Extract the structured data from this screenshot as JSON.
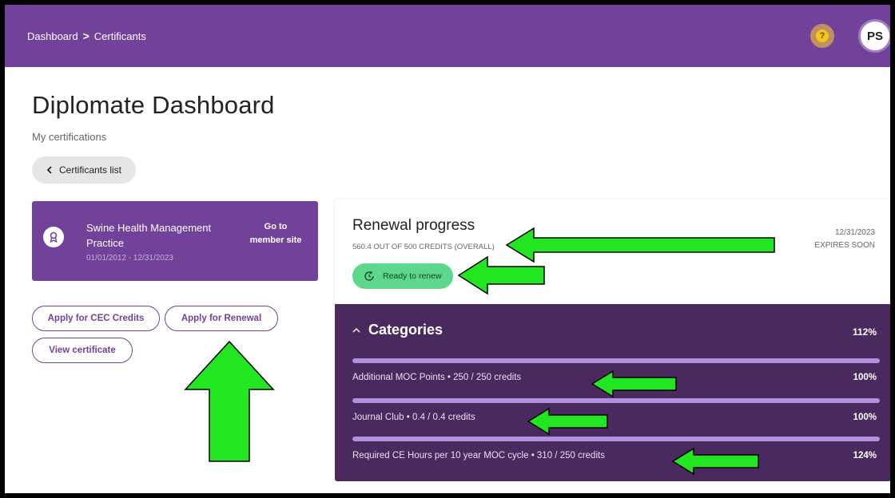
{
  "header": {
    "breadcrumb": [
      "Dashboard",
      "Certificants"
    ],
    "separator": ">",
    "help_icon": "?",
    "avatar_initials": "PS",
    "bar_color": "#72429a"
  },
  "page": {
    "title": "Diplomate Dashboard",
    "subtitle": "My certifications",
    "back_label": "Certificants list"
  },
  "certification": {
    "name": "Swine Health Management Practice",
    "dates": "01/01/2012 - 12/31/2023",
    "link_label": "Go to member site",
    "icon": "award-ribbon-icon"
  },
  "actions": {
    "apply_cec": "Apply for CEC Credits",
    "apply_renewal": "Apply for Renewal",
    "view_certificate": "View certificate"
  },
  "renewal": {
    "title": "Renewal progress",
    "credits_summary": "560.4 OUT OF 500 CREDITS (OVERALL)",
    "status": "Ready to renew",
    "expiry_date": "12/31/2023",
    "expiry_note": "EXPIRES SOON",
    "status_color": "#5dd88a"
  },
  "categories": {
    "title": "Categories",
    "total_percent": "112%",
    "items": [
      {
        "label": "Additional MOC Points • 250 / 250 credits",
        "percent": "100%",
        "fill": 100
      },
      {
        "label": "Journal Club • 0.4 / 0.4 credits",
        "percent": "100%",
        "fill": 100
      },
      {
        "label": "Required CE Hours per 10 year MOC cycle • 310 / 250 credits",
        "percent": "124%",
        "fill": 100
      }
    ]
  },
  "annotation_color": "#22e622"
}
